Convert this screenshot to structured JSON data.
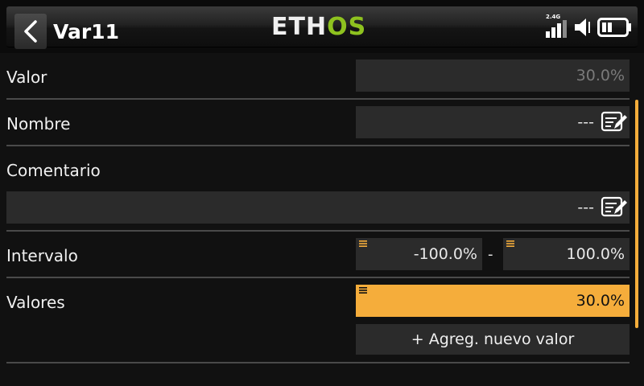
{
  "header": {
    "title": "Var11",
    "logo": {
      "part1": "ETH",
      "part2": "OS"
    },
    "signal_label": "2.4G",
    "accent_color": "#f5ad3b",
    "logo_accent_color": "#8ec21f"
  },
  "rows": {
    "valor": {
      "label": "Valor",
      "value": "30.0%"
    },
    "nombre": {
      "label": "Nombre",
      "value": "---"
    },
    "comentario": {
      "label": "Comentario",
      "value": "---"
    },
    "intervalo": {
      "label": "Intervalo",
      "min": "-100.0%",
      "separator": "-",
      "max": "100.0%"
    },
    "valores": {
      "label": "Valores",
      "value": "30.0%",
      "add_button": "+ Agreg. nuevo valor"
    }
  }
}
